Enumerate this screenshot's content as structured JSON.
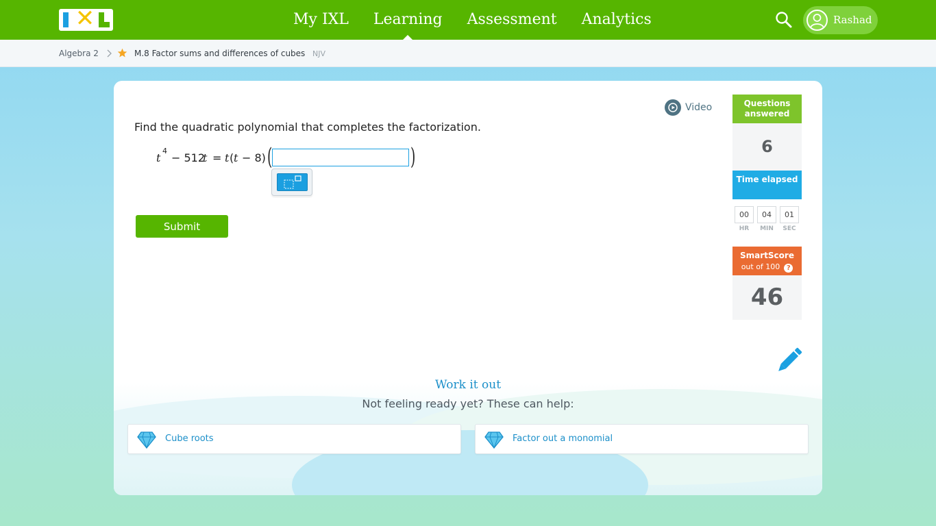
{
  "header": {
    "nav": [
      "My IXL",
      "Learning",
      "Assessment",
      "Analytics"
    ],
    "active_nav": "Learning",
    "user_name": "Rashad"
  },
  "breadcrumb": {
    "subject": "Algebra 2",
    "skill": "M.8 Factor sums and differences of cubes",
    "code": "NJV"
  },
  "question": {
    "video_label": "Video",
    "prompt": "Find the quadratic polynomial that completes the factorization.",
    "equation": {
      "base": "t",
      "exponent": "4",
      "minus_term": "− 512",
      "var": "t",
      "equals": "=",
      "rhs_factor": "t",
      "rhs_inner_open": "(",
      "rhs_inner_var": "t",
      "rhs_inner_rest": "− 8)"
    },
    "answer_value": "",
    "submit_label": "Submit"
  },
  "stats": {
    "questions_label": "Questions answered",
    "questions_answered": "6",
    "time_label": "Time elapsed",
    "time": {
      "hr": "00",
      "min": "04",
      "sec": "01"
    },
    "time_units": {
      "hr": "HR",
      "min": "MIN",
      "sec": "SEC"
    },
    "smartscore_label": "SmartScore",
    "smartscore_sub": "out of 100",
    "smartscore_help": "?",
    "smartscore": "46"
  },
  "help": {
    "title": "Work it out",
    "subtitle": "Not feeling ready yet? These can help:",
    "links": [
      "Cube roots",
      "Factor out a monomial"
    ]
  },
  "colors": {
    "brand_green": "#56b500",
    "accent_blue": "#1ba0e1",
    "smartscore_orange": "#ea6b32"
  }
}
